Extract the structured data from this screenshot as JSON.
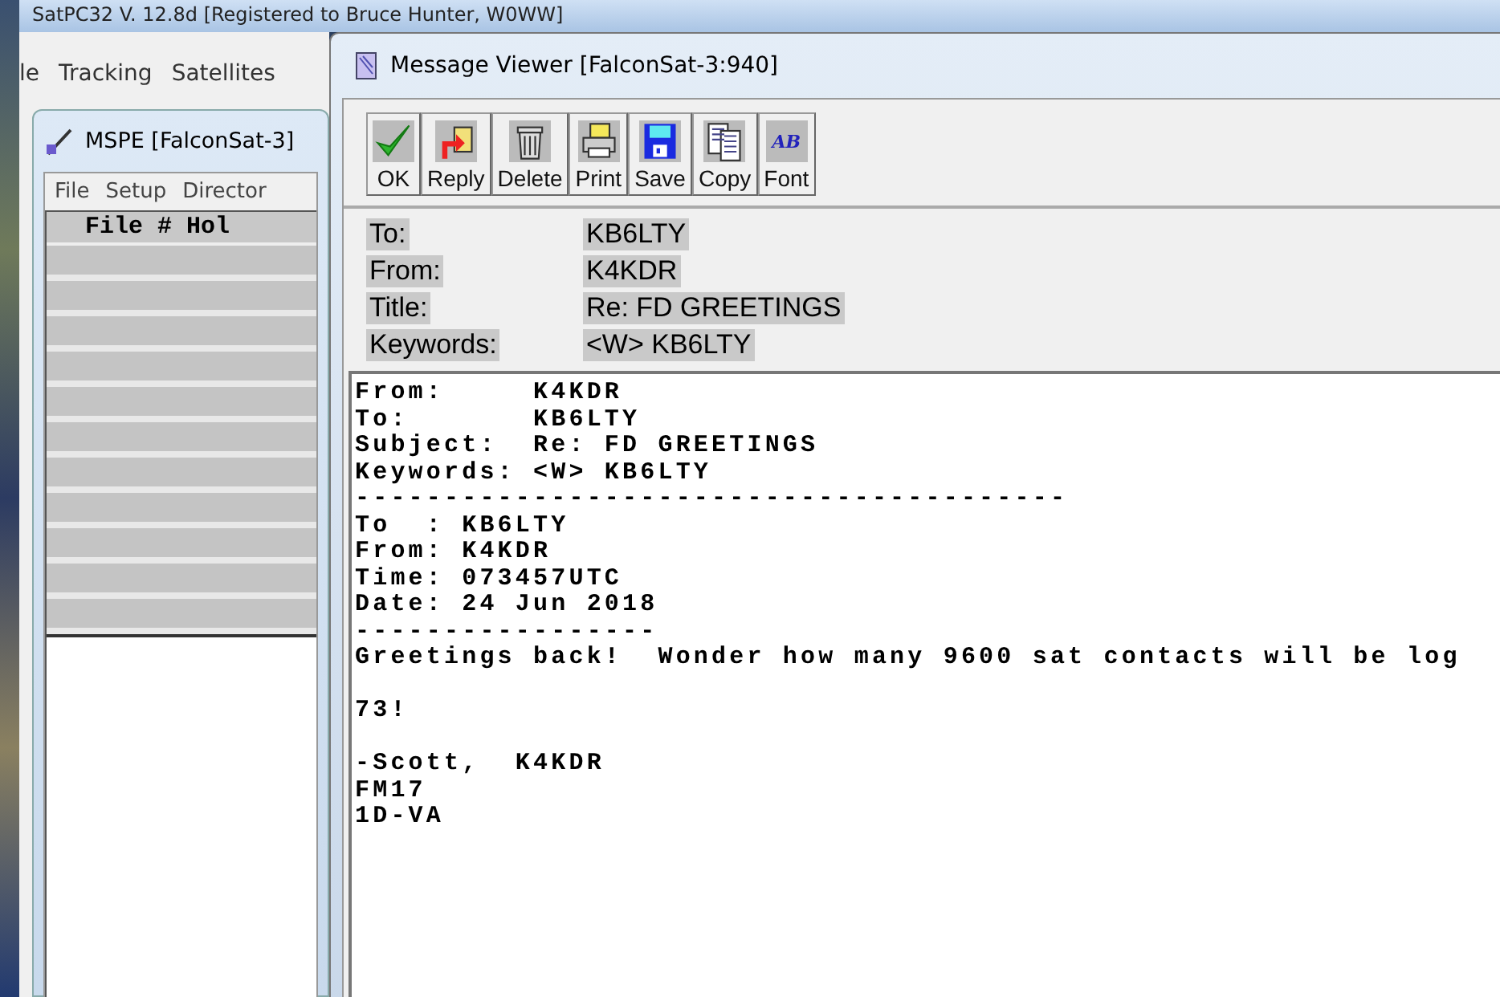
{
  "main_window": {
    "title": "SatPC32 V. 12.8d [Registered to Bruce Hunter, W0WW]",
    "menu": [
      "le",
      "Tracking",
      "Satellites"
    ]
  },
  "mspe_window": {
    "title": "MSPE [FalconSat-3]",
    "menu": [
      "File",
      "Setup",
      "Director"
    ],
    "table": {
      "header": "File # Hol"
    }
  },
  "message_viewer": {
    "title": "Message Viewer [FalconSat-3:940]",
    "toolbar": [
      {
        "label": "OK",
        "kind": "ok"
      },
      {
        "label": "Reply",
        "kind": "reply"
      },
      {
        "label": "Delete",
        "kind": "delete"
      },
      {
        "label": "Print",
        "kind": "print"
      },
      {
        "label": "Save",
        "kind": "save"
      },
      {
        "label": "Copy",
        "kind": "copy"
      },
      {
        "label": "Font",
        "kind": "font",
        "icon_text": "AB"
      }
    ],
    "fields": [
      {
        "label": "To:",
        "value": "KB6LTY"
      },
      {
        "label": "From:",
        "value": "K4KDR"
      },
      {
        "label": "Title:",
        "value": "Re: FD GREETINGS"
      },
      {
        "label": "Keywords:",
        "value": "<W> KB6LTY"
      }
    ],
    "body_blocks": [
      [
        "From:     K4KDR",
        "To:       KB6LTY",
        "Subject:  Re: FD GREETINGS",
        "Keywords: <W> KB6LTY",
        "----------------------------------------",
        "To  : KB6LTY",
        "From: K4KDR",
        "Time: 073457UTC",
        "Date: 24 Jun 2018",
        "-----------------",
        "Greetings back!  Wonder how many 9600 sat contacts will be log"
      ],
      [
        "73!"
      ],
      [
        "-Scott,  K4KDR",
        "FM17",
        "1D-VA"
      ]
    ]
  }
}
